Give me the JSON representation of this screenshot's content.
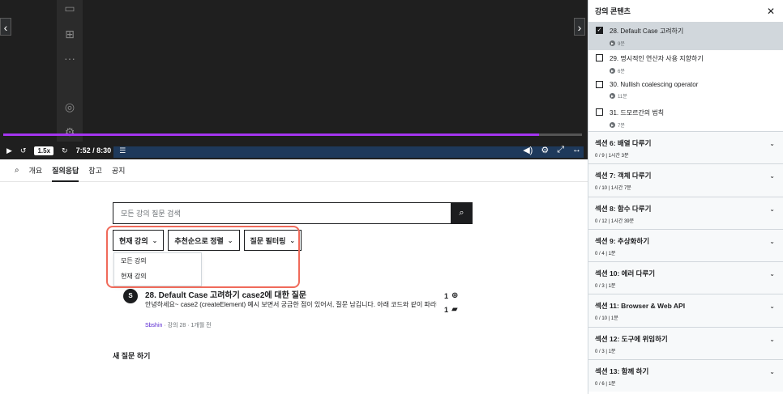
{
  "video": {
    "prev_arrow": "‹",
    "next_arrow": "›",
    "speed": "1.5x",
    "time": "7:52 / 8:30",
    "progress": 0.926,
    "status_bar": "Live Share   3 hrs 20 mins   Quokka   1h 20m   ESLint   Spell   Prettier"
  },
  "tabs": [
    {
      "label": "개요"
    },
    {
      "label": "질의응답"
    },
    {
      "label": "참고"
    },
    {
      "label": "공지"
    }
  ],
  "search": {
    "placeholder": "모든 강의 질문 검색"
  },
  "filters": {
    "lecture": "현재 강의",
    "sort": "추천순으로 정렬",
    "filter": "질문 필터링"
  },
  "dropdown": {
    "items": [
      "모든 강의",
      "현재 강의"
    ]
  },
  "question": {
    "avatar": "S",
    "title": "28. Default Case 고려하기 case2에 대한 질문",
    "body": "안녕하세요~ case2 (createElement) 예시 보면서 궁금한 점이 있어서, 질문 남깁니다. 아래 코드와 같이 파라미터...",
    "author": "Sbshin",
    "meta": " · 강의 28 · 1개월 전",
    "upvotes": "1",
    "replies": "1"
  },
  "new_question": "새 질문 하기",
  "sidebar": {
    "title": "강의 콘텐츠",
    "lectures": [
      {
        "title": "28. Default Case 고려하기",
        "duration": "9분",
        "checked": true
      },
      {
        "title": "29. 명시적인 연산자 사용 지향하기",
        "duration": "6분",
        "checked": false
      },
      {
        "title": "30. Nullish coalescing operator",
        "duration": "11분",
        "checked": false
      },
      {
        "title": "31. 드모르간의 법칙",
        "duration": "7분",
        "checked": false
      }
    ],
    "sections": [
      {
        "title": "섹션 6: 배열 다루기",
        "meta": "0 / 9 | 1시간 3분"
      },
      {
        "title": "섹션 7: 객체 다루기",
        "meta": "0 / 10 | 1시간 7분"
      },
      {
        "title": "섹션 8: 함수 다루기",
        "meta": "0 / 12 | 1시간 39분"
      },
      {
        "title": "섹션 9: 추상화하기",
        "meta": "0 / 4 | 1분"
      },
      {
        "title": "섹션 10: 에러 다루기",
        "meta": "0 / 3 | 1분"
      },
      {
        "title": "섹션 11: Browser & Web API",
        "meta": "0 / 10 | 1분"
      },
      {
        "title": "섹션 12: 도구에 위임하기",
        "meta": "0 / 3 | 1분"
      },
      {
        "title": "섹션 13: 함께 하기",
        "meta": "0 / 6 | 1분"
      }
    ]
  }
}
